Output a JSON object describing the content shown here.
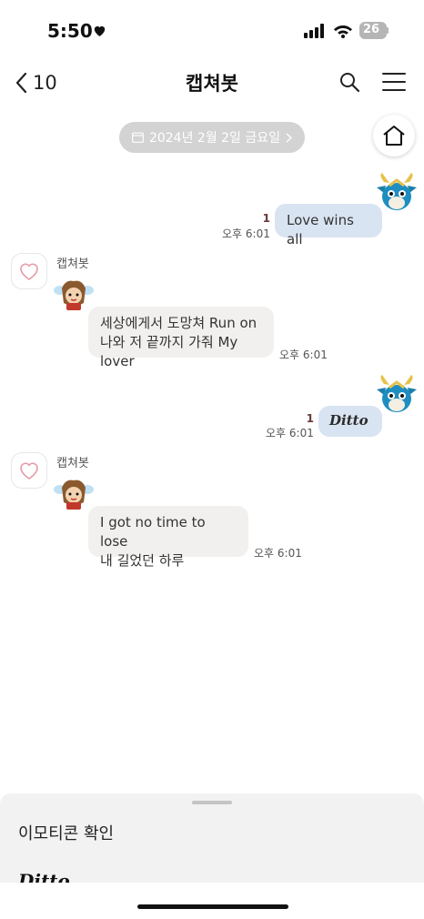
{
  "status_bar": {
    "time": "5:50",
    "battery": "26",
    "icons": [
      "heart-icon",
      "signal-icon",
      "wifi-icon",
      "battery-icon"
    ]
  },
  "nav": {
    "back_count": "10",
    "title": "캡쳐봇",
    "icons": [
      "back-chevron-icon",
      "search-icon",
      "menu-icon"
    ]
  },
  "date_pill": "2024년 2월 2일 금요일",
  "messages": [
    {
      "sender": "me",
      "text": "Love wins all",
      "read": "1",
      "time": "오후 6:01"
    },
    {
      "sender": "bot",
      "name": "캡쳐봇",
      "line1": "세상에게서 도망쳐 Run on",
      "line2": "나와 저 끝까지 가줘 My lover",
      "time": "오후 6:01"
    },
    {
      "sender": "me",
      "text": "Ditto",
      "read": "1",
      "time": "오후 6:01"
    },
    {
      "sender": "bot",
      "name": "캡쳐봇",
      "line1": "I got no time to lose",
      "line2": "내 길었던 하루",
      "time": "오후 6:01"
    }
  ],
  "sheet": {
    "title": "이모티콘 확인",
    "preview": "Ditto"
  },
  "colors": {
    "my_bubble": "#d9e4f2",
    "bot_bubble": "#f2f0ef",
    "read_count": "#6b3b3b",
    "date_pill": "#d3d3d3"
  }
}
